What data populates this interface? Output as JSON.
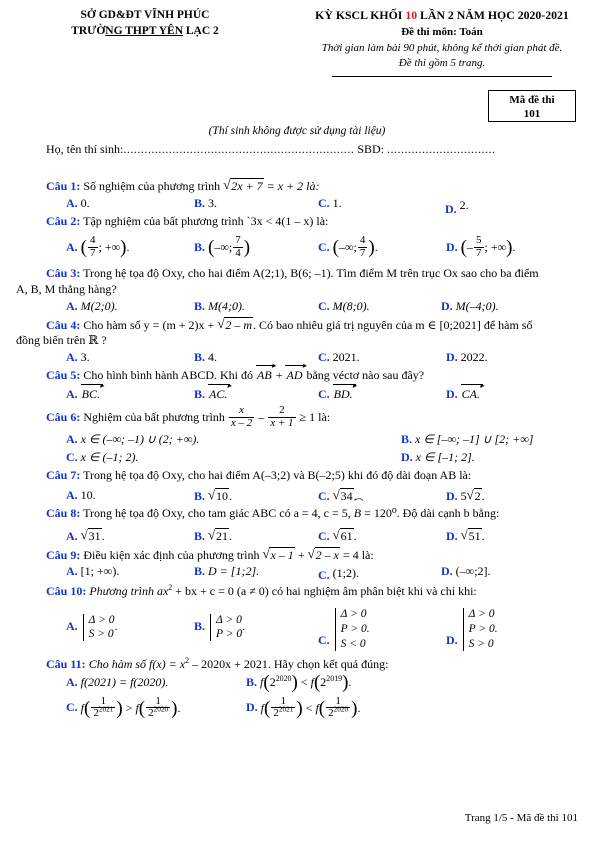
{
  "header": {
    "left_line1": "SỞ GD&ĐT VĨNH PHÚC",
    "left_line2_pre": "TRƯỜ",
    "left_line2_underline": "NG THPT YÊN",
    "left_line2_post": " LẠC 2",
    "title_pre": "KỲ KSCL KHỐI ",
    "title_highlight": "10",
    "title_post": " LẦN 2 NĂM HỌC 2020-2021",
    "highlight_color": "#e8121a",
    "subject": "Đề thi môn: Toán",
    "time_note": "Thời gian làm bài 90 phút, không kể thời gian phát đề.",
    "pages_note": "Đề thi gồm 5 trang."
  },
  "code_box": {
    "label": "Mã đề thi",
    "value": "101"
  },
  "notice": "(Thí sinh không được sử dụng tài liệu)",
  "candidate": {
    "name_label": "Họ, tên thí sinh:",
    "name_dots": "..................................................................",
    "sbd_label": "SBD:",
    "sbd_dots": "..............................."
  },
  "option_letters": {
    "a": "A.",
    "b": "B.",
    "c": "C.",
    "d": "D."
  },
  "questions": [
    {
      "label": "Câu 1:",
      "stem_1": "Số nghiệm của phương trình ",
      "sqrt_body": "2x + 7",
      "stem_2": " = x + 2 là:",
      "a": "0.",
      "b": "3.",
      "c": "1.",
      "d": "2."
    },
    {
      "label": "Câu 2:",
      "stem": "Tập nghiệm của bất phương trình `3x < 4(1 – x) là:",
      "a_num": "4",
      "a_den": "7",
      "a_tail": "; +∞",
      "b_head": "–∞;",
      "b_num": "7",
      "b_den": "4",
      "c_head": "–∞;",
      "c_num": "4",
      "c_den": "7",
      "d_num": "5",
      "d_den": "7",
      "d_tail": "; +∞"
    },
    {
      "label": "Câu 3:",
      "stem_line1": "Trong hệ tọa độ Oxy, cho hai điểm A(2;1), B(6; –1). Tìm điểm M trên trục Ox sao cho ba điểm",
      "stem_line2": "A, B, M thẳng hàng?",
      "a": "M(2;0).",
      "b": "M(4;0).",
      "c": "M(8;0).",
      "d": "M(–4;0)."
    },
    {
      "label": "Câu 4:",
      "stem_line1_a": "Cho hàm số y = (m + 2)x + ",
      "stem_sqrt": "2 – m",
      "stem_line1_b": ". Có bao nhiêu giá trị nguyên của m ∈ [0;2021] để hàm số",
      "stem_line2": "đồng biến trên ℝ ?",
      "a": "3.",
      "b": "4.",
      "c": "2021.",
      "d": "2022."
    },
    {
      "label": "Câu 5:",
      "stem_1": "Cho hình bình hành ABCD. Khi đó ",
      "vec1": "AB",
      "stem_2": " + ",
      "vec2": "AD",
      "stem_3": " bằng véctơ nào sau đây?",
      "a": "BC.",
      "b": "AC.",
      "c": "BD.",
      "d": "CA."
    },
    {
      "label": "Câu 6:",
      "stem_1": "Nghiệm của bất phương trình ",
      "f1_num": "x",
      "f1_den": "x – 2",
      "minus": " – ",
      "f2_num": "2",
      "f2_den": "x + 1",
      "stem_2": " ≥ 1 là:",
      "a": "x ∈ (–∞; –1) ∪ (2; +∞).",
      "b": "x ∈ [–∞; –1] ∪ [2; +∞]",
      "c": "x ∈ (–1; 2).",
      "d": "x ∈ [–1; 2]."
    },
    {
      "label": "Câu 7:",
      "stem": "Trong hệ tọa độ Oxy, cho hai điểm A(–3;2) và B(–2;5) khi đó độ dài đoạn AB là:",
      "a": "10.",
      "b_sqrt": "10",
      "b_tail": ".",
      "c_sqrt": "34",
      "c_tail": ".",
      "d_pre": "5",
      "d_sqrt": "2",
      "d_tail": "."
    },
    {
      "label": "Câu 8:",
      "stem_1": "Trong hệ tọa độ Oxy, cho tam giác ABC có a = 4, c = 5, ",
      "stem_hat": "B",
      "stem_2": " = 120⁰. Độ dài cạnh b bằng:",
      "a_sqrt": "31",
      "b_sqrt": "21",
      "c_sqrt": "61",
      "d_sqrt": "51",
      "tail": "."
    },
    {
      "label": "Câu 9:",
      "stem_1": "Điều kiện xác định của phương trình ",
      "sqrt1": "x – 1",
      "stem_2": " + ",
      "sqrt2": "2 – x",
      "stem_3": " = 4 là:",
      "a": "[1; +∞).",
      "b": "D = [1;2].",
      "c": "(1;2).",
      "d": "(–∞;2]."
    },
    {
      "label": "Câu 10:",
      "stem_1": "Phương trình ax",
      "stem_sup": "2",
      "stem_2": " + bx + c = 0 (a ≠ 0) có hai nghiệm âm phân biệt khi và chỉ khi:",
      "a_lines": [
        "Δ > 0",
        "S > 0"
      ],
      "a_dot": ".",
      "b_lines": [
        "Δ > 0",
        "P > 0"
      ],
      "b_dot": ".",
      "c_lines": [
        "Δ > 0",
        "P > 0.",
        "S < 0"
      ],
      "d_lines": [
        "Δ > 0",
        "P > 0.",
        "S > 0"
      ]
    },
    {
      "label": "Câu 11:",
      "stem_1": "Cho hàm số f(x) = x",
      "stem_sup": "2",
      "stem_2": " – 2020x + 2021. Hãy chọn kết quả đúng:",
      "a": "f(2021) = f(2020).",
      "b_f1_exp": "2020",
      "b_f2_exp": "2019",
      "b_rel": " < ",
      "c_exp1": "2021",
      "c_exp2": "2020",
      "c_rel": " > ",
      "d_exp1": "2021",
      "d_exp2": "2020",
      "d_rel": " < "
    }
  ],
  "footer": "Trang 1/5 - Mã đề thi 101"
}
